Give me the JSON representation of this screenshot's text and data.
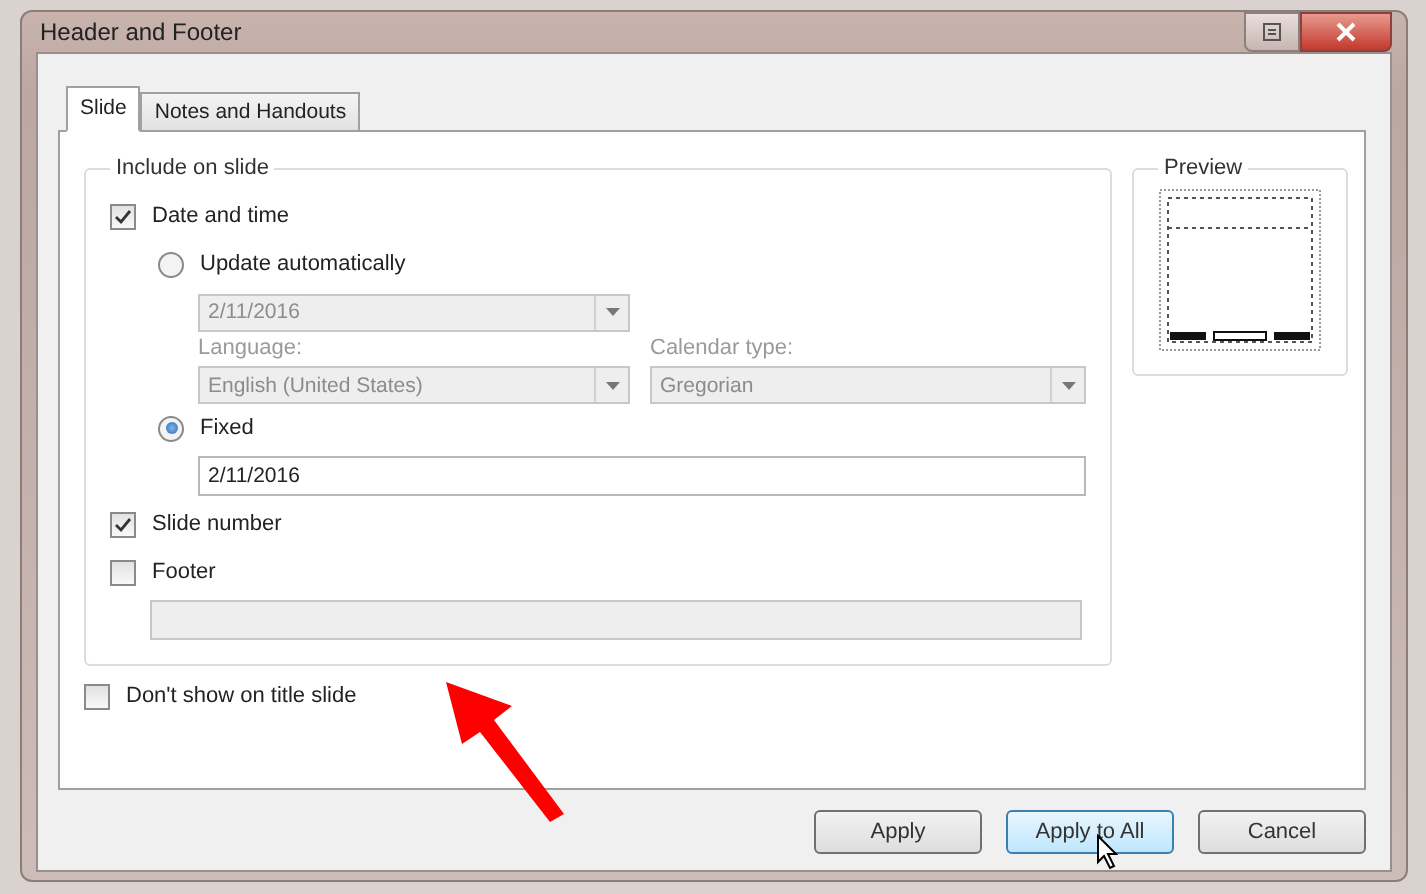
{
  "window": {
    "title": "Header and Footer"
  },
  "tabs": [
    {
      "label": "Slide",
      "selected": true
    },
    {
      "label": "Notes and Handouts",
      "selected": false
    }
  ],
  "include_group": {
    "title": "Include on slide",
    "date_and_time": {
      "label": "Date and time",
      "checked": true
    },
    "update_automatically": {
      "label": "Update automatically",
      "selected": false
    },
    "auto_date": {
      "value": "2/11/2016",
      "disabled": true
    },
    "language": {
      "label": "Language:",
      "value": "English (United States)",
      "disabled": true
    },
    "calendar_type": {
      "label": "Calendar type:",
      "value": "Gregorian",
      "disabled": true
    },
    "fixed": {
      "label": "Fixed",
      "selected": true
    },
    "fixed_date": {
      "value": "2/11/2016",
      "disabled": false
    },
    "slide_number": {
      "label": "Slide number",
      "checked": true
    },
    "footer": {
      "label": "Footer",
      "checked": false
    },
    "footer_text": {
      "disabled": true
    }
  },
  "dont_show_on_title_slide": {
    "label": "Don't show on title slide",
    "checked": false
  },
  "preview": {
    "title": "Preview"
  },
  "buttons": [
    {
      "label": "Apply",
      "focused": false
    },
    {
      "label": "Apply to All",
      "focused": true
    },
    {
      "label": "Cancel",
      "focused": false
    }
  ]
}
